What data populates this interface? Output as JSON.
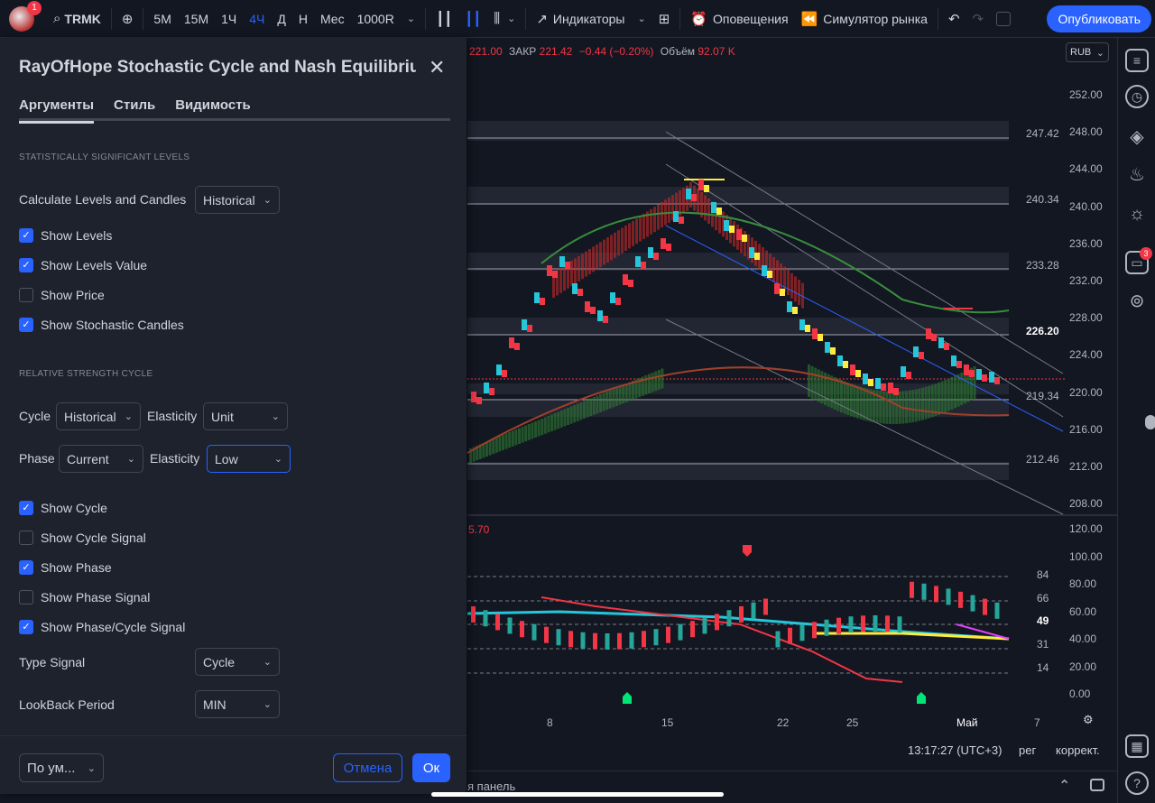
{
  "toolbar": {
    "avatar_badge": "1",
    "symbol": "TRMK",
    "intervals": [
      "5М",
      "15М",
      "1Ч",
      "4Ч",
      "Д",
      "Н",
      "Мес",
      "1000R"
    ],
    "active_interval": "4Ч",
    "indicators": "Индикаторы",
    "alerts": "Оповещения",
    "simulator": "Симулятор рынка",
    "publish": "Опубликовать"
  },
  "chart": {
    "ohlc_prefix": "221.00",
    "close_label": "ЗАКР",
    "close_value": "221.42",
    "change": "−0.44 (−0.20%)",
    "volume_label": "Объём",
    "volume_value": "92.07 K",
    "currency": "RUB",
    "price_axis": [
      "252.00",
      "248.00",
      "244.00",
      "240.00",
      "236.00",
      "232.00",
      "228.00",
      "224.00",
      "220.00",
      "216.00",
      "212.00",
      "208.00"
    ],
    "level_labels": [
      "247.42",
      "240.34",
      "233.28",
      "226.20",
      "219.34",
      "212.46"
    ],
    "current_price": "226.20",
    "sub_value": "5.70",
    "sub_axis": [
      "120.00",
      "100.00",
      "80.00",
      "60.00",
      "40.00",
      "20.00",
      "0.00"
    ],
    "sub_levels": [
      "84",
      "66",
      "49",
      "31",
      "14"
    ],
    "x_axis": [
      "8",
      "15",
      "22",
      "25",
      "Май",
      "7"
    ],
    "time": "13:17:27 (UTC+3)",
    "mode_reg": "рег",
    "mode_adj": "коррект.",
    "bottom_panel": "я панель"
  },
  "rightbar": {
    "chat_badge": "3"
  },
  "modal": {
    "title": "RayOfHope Stochastic Cycle and Nash Equilibriu...",
    "tabs": [
      "Аргументы",
      "Стиль",
      "Видимость"
    ],
    "section1": "STATISTICALLY SIGNIFICANT LEVELS",
    "calc_label": "Calculate Levels and Candles",
    "calc_value": "Historical",
    "cb1": [
      {
        "label": "Show Levels",
        "checked": true
      },
      {
        "label": "Show Levels Value",
        "checked": true
      },
      {
        "label": "Show Price",
        "checked": false
      },
      {
        "label": "Show Stochastic Candles",
        "checked": true
      }
    ],
    "section2": "RELATIVE STRENGTH CYCLE",
    "cycle_label": "Cycle",
    "cycle_value": "Historical",
    "elasticity_label": "Elasticity",
    "elasticity1_value": "Unit",
    "phase_label": "Phase",
    "phase_value": "Current",
    "elasticity2_value": "Low",
    "cb2": [
      {
        "label": "Show Cycle",
        "checked": true
      },
      {
        "label": "Show Cycle Signal",
        "checked": false
      },
      {
        "label": "Show Phase",
        "checked": true
      },
      {
        "label": "Show Phase Signal",
        "checked": false
      },
      {
        "label": "Show Phase/Cycle Signal",
        "checked": true
      }
    ],
    "type_signal_label": "Type Signal",
    "type_signal_value": "Cycle",
    "lookback_label": "LookBack Period",
    "lookback_value": "MIN",
    "default_btn": "По ум...",
    "cancel": "Отмена",
    "ok": "Ок"
  }
}
